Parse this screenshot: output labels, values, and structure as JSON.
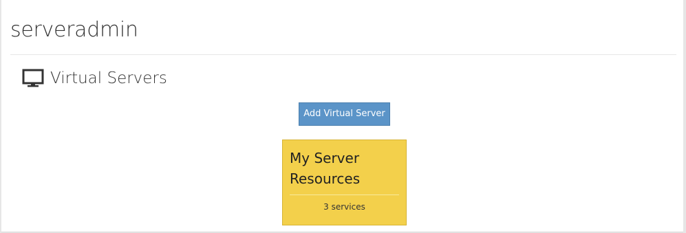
{
  "app": {
    "title": "serveradmin"
  },
  "section": {
    "title": "Virtual Servers",
    "icon": "monitor-icon"
  },
  "toolbar": {
    "add_label": "Add Virtual Server"
  },
  "servers": [
    {
      "name": "My Server Resources",
      "services": "3 services"
    }
  ],
  "colors": {
    "button_background": "#5b94c8",
    "card_background": "#f3d04b"
  }
}
